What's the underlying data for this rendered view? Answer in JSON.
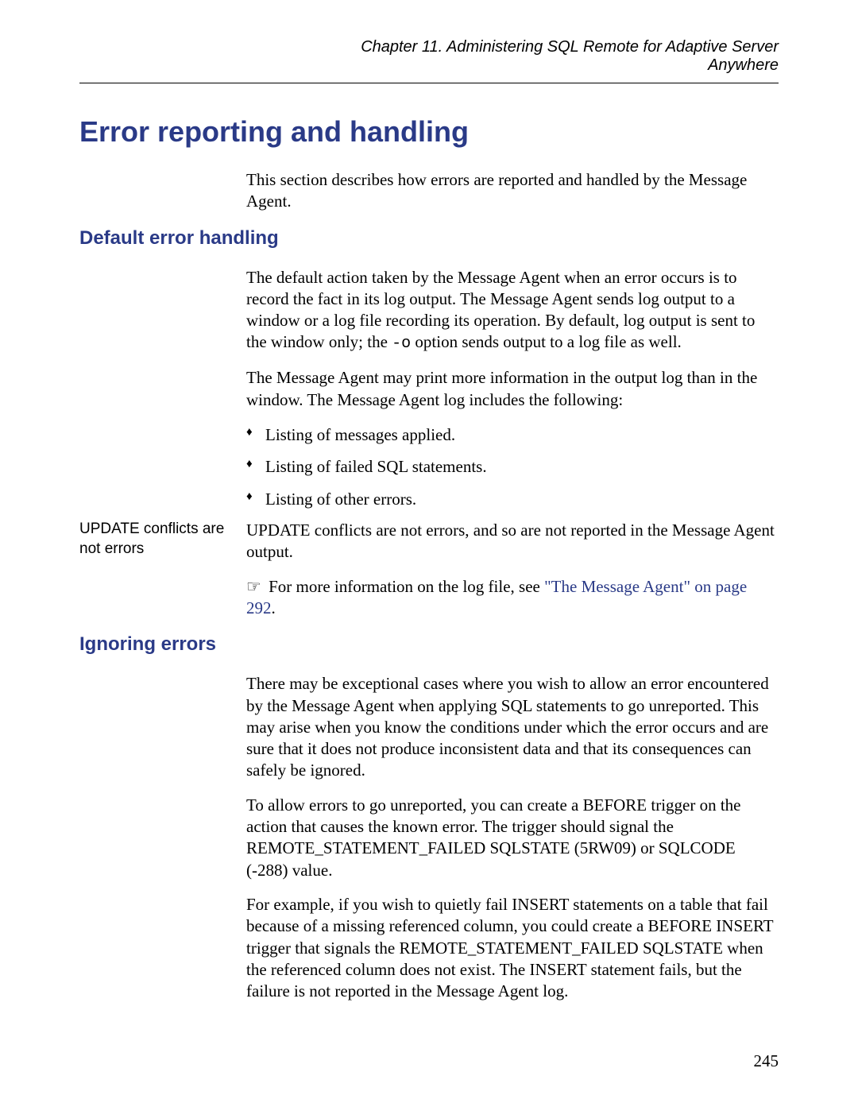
{
  "header": {
    "line1": "Chapter 11.  Administering SQL Remote for Adaptive Server",
    "line2": "Anywhere"
  },
  "title": "Error reporting and handling",
  "intro": "This section describes how errors are reported and handled by the Message Agent.",
  "section1": {
    "heading": "Default error handling",
    "para1_a": "The default action taken by the Message Agent when an error occurs is to record the fact in its log output. The Message Agent sends log output to a window or a log file recording its operation. By default, log output is sent to the window only; the ",
    "para1_code": "-o",
    "para1_b": " option sends output to a log file as well.",
    "para2": "The Message Agent may print more information in the output log than in the window. The Message Agent log includes the following:",
    "bullets": [
      "Listing of messages applied.",
      "Listing of failed SQL statements.",
      "Listing of other errors."
    ],
    "sidenote_label": "UPDATE conflicts are not errors",
    "sidenote_body": "UPDATE conflicts are not errors, and so are not reported in the Message Agent output.",
    "xref_lead": "For more information on the log file, see ",
    "xref_link": "\"The Message Agent\" on page 292",
    "xref_tail": "."
  },
  "section2": {
    "heading": "Ignoring errors",
    "para1": "There may be exceptional cases where you wish to allow an error encountered by the Message Agent when applying SQL statements to go unreported. This may arise when you know the conditions under which the error occurs and are sure that it does not produce inconsistent data and that its consequences can safely be ignored.",
    "para2": "To allow errors to go unreported, you can create a BEFORE trigger on the action that causes the known error. The trigger should signal the REMOTE_STATEMENT_FAILED SQLSTATE (5RW09) or SQLCODE (-288) value.",
    "para3": "For example, if you wish to quietly fail INSERT statements on a table that fail because of a missing referenced column, you could create a BEFORE INSERT trigger that signals the REMOTE_STATEMENT_FAILED SQLSTATE when the referenced column does not exist. The INSERT statement fails, but the failure is not reported in the Message Agent log."
  },
  "page_number": "245",
  "icons": {
    "pointer": "☞"
  }
}
